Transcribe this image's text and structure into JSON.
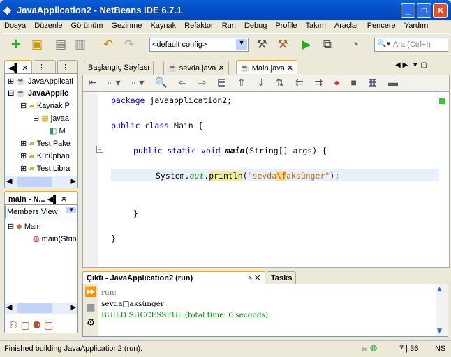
{
  "window": {
    "title": "JavaApplication2 - NetBeans IDE 6.7.1"
  },
  "menu": [
    "Dosya",
    "Düzenle",
    "Görünüm",
    "Gezinme",
    "Kaynak",
    "Refaktor",
    "Run",
    "Debug",
    "Profile",
    "Takım",
    "Araçlar",
    "Pencere",
    "Yardım"
  ],
  "toolbar": {
    "config": "<default config>",
    "search_placeholder": "Ara (Ctrl+I)"
  },
  "projects": {
    "items": [
      "JavaApplicati",
      "JavaApplic",
      "Kaynak P",
      "javaa",
      "M",
      "Test Pake",
      "Kütüphan",
      "Test Libra"
    ]
  },
  "navigator": {
    "title": "main - N...",
    "filter": "Members View",
    "items": [
      "Main",
      "main(Strin"
    ]
  },
  "editor": {
    "tabs": [
      "Başlangıç Sayfası",
      "sevda.java",
      "Main.java"
    ],
    "lines": {
      "l1a": "package",
      "l1b": " javaapplication2;",
      "l2a": "public class",
      "l2b": " Main {",
      "l3a": "public static void ",
      "l3b": "main",
      "l3c": "(String[] args) {",
      "l4a": "System.",
      "l4b": "out",
      "l4c": ".",
      "l4d": "println",
      "l4e": "(",
      "l4f": "\"sevda",
      "l4g": "\\f",
      "l4h": "aksünger\"",
      "l4i": ");",
      "l5": "}",
      "l6": "}"
    }
  },
  "output": {
    "tabs": [
      "Çıktı - JavaApplication2 (run)",
      "Tasks"
    ],
    "lines": [
      "run:",
      "sevda□aksünger",
      "BUILD SUCCESSFUL (total time: 0 seconds)"
    ]
  },
  "status": {
    "message": "Finished building JavaApplication2 (run).",
    "position": "7 | 36",
    "mode": "INS"
  }
}
